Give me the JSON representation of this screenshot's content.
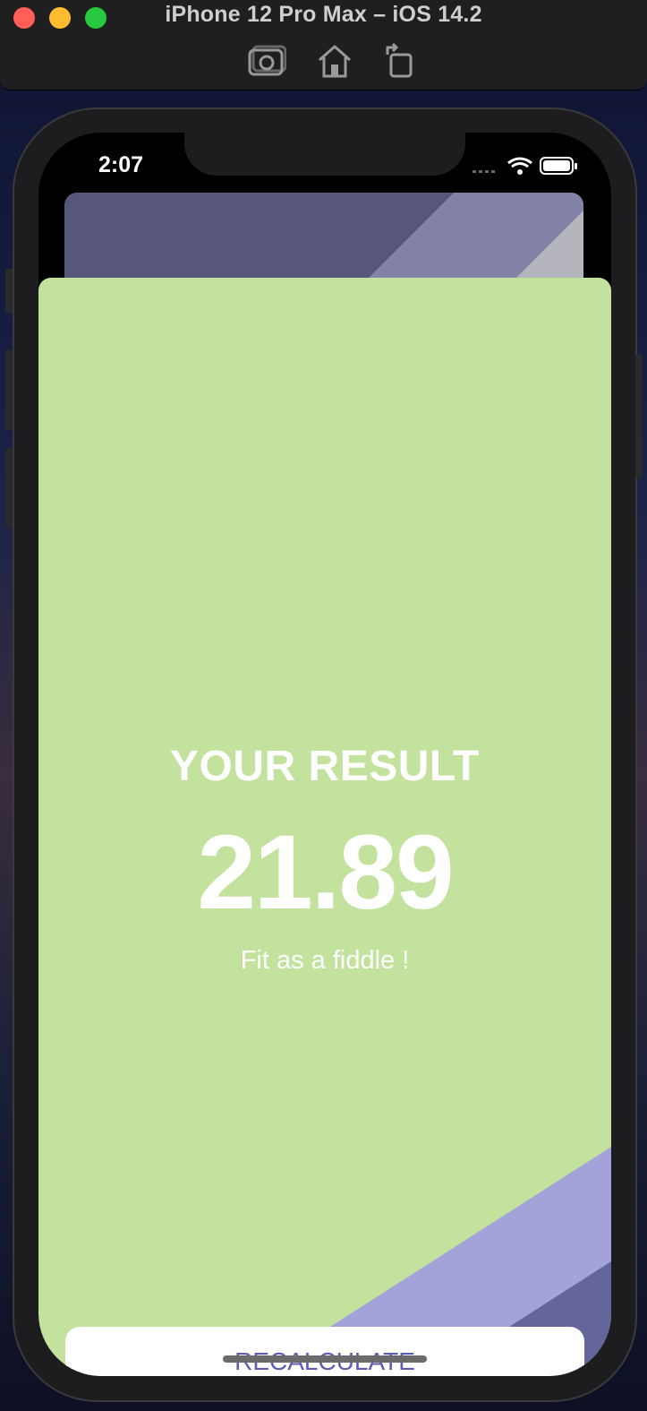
{
  "simulator": {
    "title": "iPhone 12 Pro Max – iOS 14.2",
    "tools": [
      "screenshot-icon",
      "home-icon",
      "rotate-icon"
    ]
  },
  "status_bar": {
    "time": "2:07",
    "icons": [
      "signal-icon",
      "wifi-icon",
      "battery-icon"
    ]
  },
  "result": {
    "title": "YOUR RESULT",
    "value": "21.89",
    "description": "Fit as a fiddle !",
    "button_label": "RECALCULATE"
  },
  "colors": {
    "card": "#c2e29d",
    "stripe_light": "#a3a3d9",
    "stripe_dark": "#64659a",
    "button_text": "#5c5db0",
    "back_sheet": "#56577b"
  }
}
